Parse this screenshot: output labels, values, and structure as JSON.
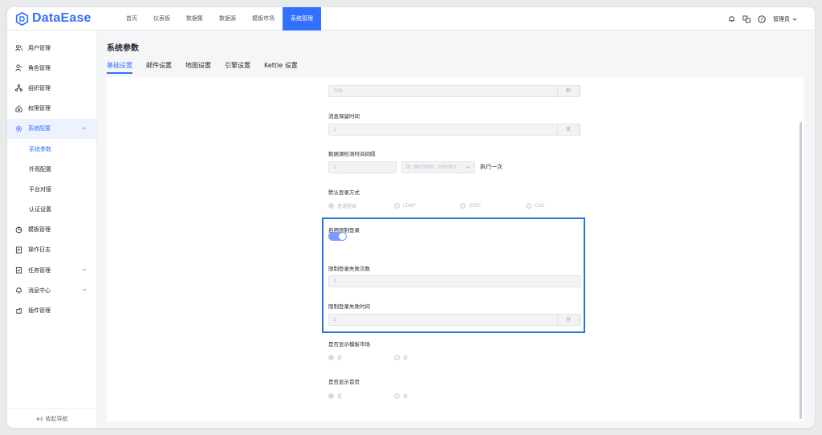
{
  "brand": {
    "name": "DataEase",
    "color": "#3370ff"
  },
  "topnav": {
    "items": [
      {
        "label": "首页",
        "active": false
      },
      {
        "label": "仪表板",
        "active": false
      },
      {
        "label": "数据集",
        "active": false
      },
      {
        "label": "数据源",
        "active": false
      },
      {
        "label": "模板市场",
        "active": false
      },
      {
        "label": "系统管理",
        "active": true
      }
    ],
    "icons": [
      "bell-icon",
      "translate-icon",
      "help-icon"
    ],
    "user": "管理员"
  },
  "sidebar": {
    "items": [
      {
        "label": "用户管理",
        "icon": "users-icon"
      },
      {
        "label": "角色管理",
        "icon": "role-icon"
      },
      {
        "label": "组织管理",
        "icon": "org-icon"
      },
      {
        "label": "权限管理",
        "icon": "permission-icon"
      },
      {
        "label": "系统配置",
        "icon": "gear-icon",
        "open": true
      },
      {
        "label": "系统参数",
        "sub": true,
        "active": true
      },
      {
        "label": "外观配置",
        "sub": true
      },
      {
        "label": "平台对接",
        "sub": true
      },
      {
        "label": "认证设置",
        "sub": true
      },
      {
        "label": "模板管理",
        "icon": "template-icon"
      },
      {
        "label": "操作日志",
        "icon": "log-icon"
      },
      {
        "label": "任务管理",
        "icon": "task-icon",
        "expandable": true
      },
      {
        "label": "消息中心",
        "icon": "bell-icon",
        "expandable": true
      },
      {
        "label": "插件管理",
        "icon": "plugin-icon"
      }
    ],
    "collapse_label": "收起导航"
  },
  "page": {
    "title": "系统参数",
    "tabs": [
      {
        "label": "基础设置",
        "active": true
      },
      {
        "label": "邮件设置"
      },
      {
        "label": "地图设置"
      },
      {
        "label": "引擎设置"
      },
      {
        "label": "Kettle 设置"
      }
    ]
  },
  "form": {
    "top_field": {
      "value": "300",
      "suffix": "秒"
    },
    "msg_retention": {
      "label": "消息保留时间",
      "value": "2",
      "suffix": "天"
    },
    "ds_check": {
      "label": "数据源检测时间间隔",
      "value": "1",
      "unit_value": "时 (执行时间：0分0秒)",
      "after": "执行一次"
    },
    "login_method": {
      "label": "默认登录方式",
      "options": [
        "普通登录",
        "LDAP",
        "OIDC",
        "CAS"
      ],
      "selected": 0
    },
    "limit_login": {
      "label": "启用限制登录",
      "enabled": true
    },
    "fail_count": {
      "label": "限制登录失败次数",
      "value": "3"
    },
    "fail_time": {
      "label": "限制登录失败时间",
      "value": "2",
      "suffix": "分"
    },
    "show_market": {
      "label": "是否显示模板市场",
      "options": [
        "是",
        "否"
      ],
      "selected": 0
    },
    "show_home": {
      "label": "是否显示首页",
      "options": [
        "是",
        "否"
      ],
      "selected": 0
    }
  },
  "colors": {
    "accent": "#3370ff",
    "highlight_border": "#2476d1",
    "toggle_on": "#7a9bff"
  }
}
